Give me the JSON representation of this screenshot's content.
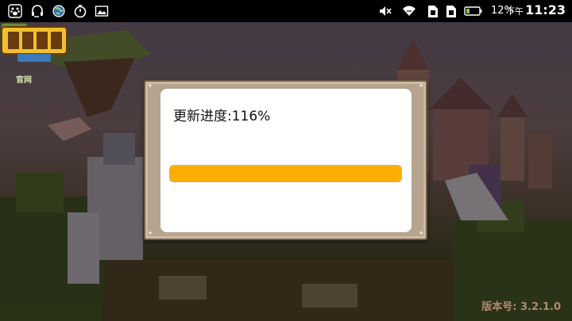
{
  "statusbar": {
    "left_icons": [
      "paw-icon",
      "headset-icon",
      "globe-icon",
      "stopwatch-icon",
      "image-icon"
    ],
    "right_icons": [
      "mute-icon",
      "wifi-icon",
      "sim-card-icon",
      "sim-card-icon",
      "battery-icon"
    ],
    "battery_percent": "12%",
    "time_period": "下午",
    "time": "11:23",
    "battery_level": 0.12
  },
  "game": {
    "home_label": "官网",
    "version_text": "版本号: 3.2.1.0"
  },
  "dialog": {
    "progress_label": "更新进度:116%",
    "progress_value": 1.0,
    "colors": {
      "fill": "#ffad00",
      "panel": "#ffffff",
      "frame": "#b6a48e"
    }
  }
}
